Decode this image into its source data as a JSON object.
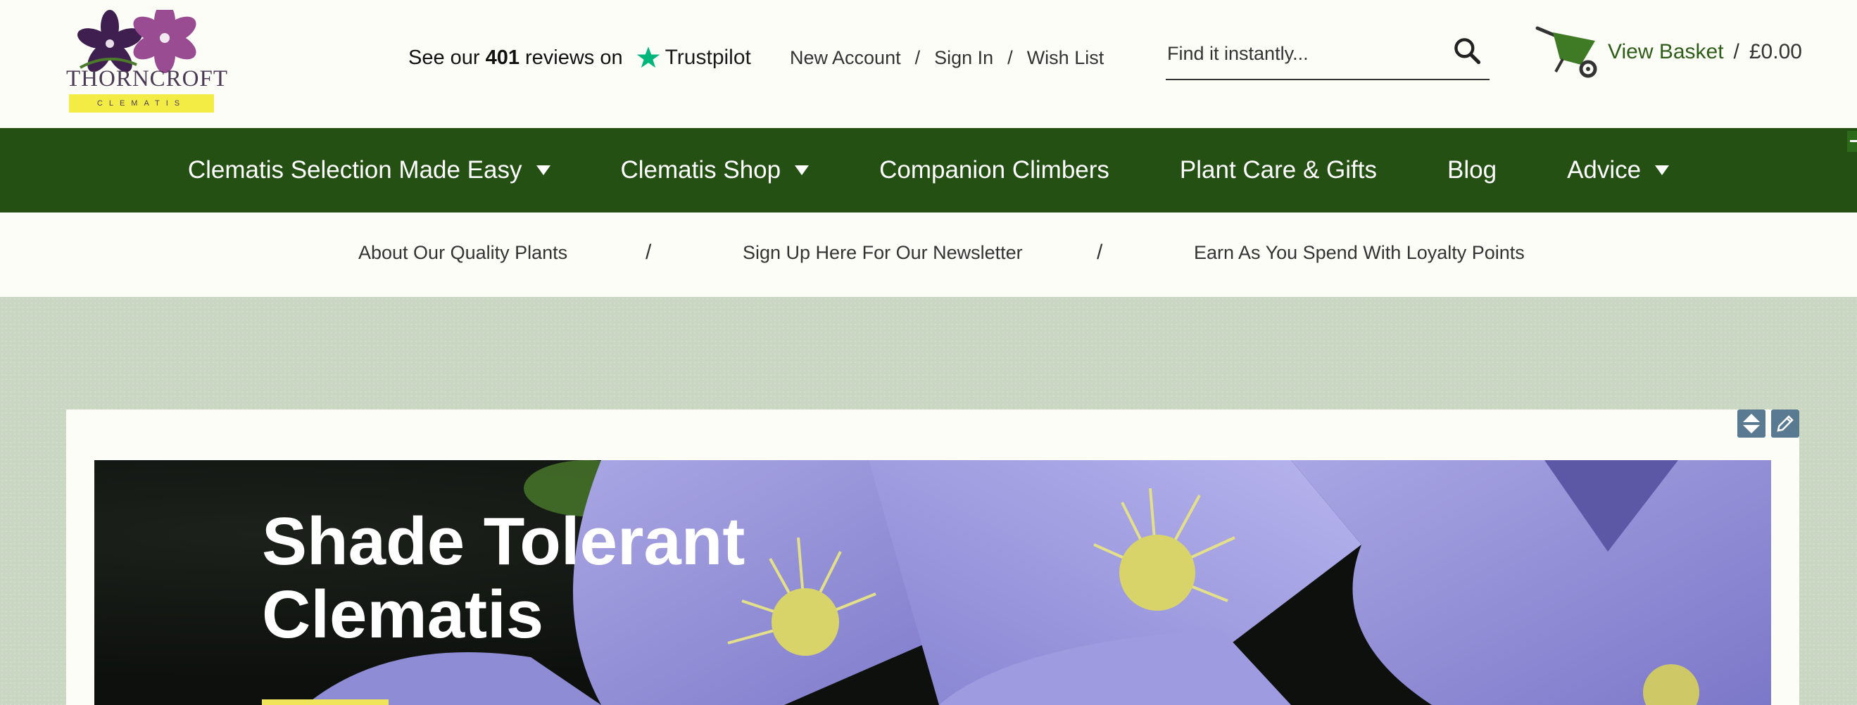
{
  "brand": {
    "name": "THORNCROFT",
    "tagline": "CLEMATIS"
  },
  "trustpilot": {
    "prefix": "See our",
    "count": "401",
    "suffix": "reviews on",
    "name": "Trustpilot",
    "star_color": "#00b67a"
  },
  "account_links": [
    {
      "label": "New Account"
    },
    {
      "label": "Sign In"
    },
    {
      "label": "Wish List"
    }
  ],
  "separators": {
    "slash": "/"
  },
  "search": {
    "placeholder": "Find it instantly...",
    "icon": "magnifier-icon"
  },
  "basket": {
    "icon": "wheelbarrow-icon",
    "label": "View Basket",
    "total": "£0.00"
  },
  "main_nav": [
    {
      "label": "Clematis Selection Made Easy",
      "dropdown": true
    },
    {
      "label": "Clematis Shop",
      "dropdown": true
    },
    {
      "label": "Companion Climbers",
      "dropdown": false
    },
    {
      "label": "Plant Care & Gifts",
      "dropdown": false
    },
    {
      "label": "Blog",
      "dropdown": false
    },
    {
      "label": "Advice",
      "dropdown": true
    }
  ],
  "sub_nav": [
    {
      "label": "About Our Quality Plants"
    },
    {
      "label": "Sign Up Here For Our Newsletter"
    },
    {
      "label": "Earn As You Spend With Loyalty Points"
    }
  ],
  "hero": {
    "title_line1": "Shade Tolerant",
    "title_line2": "Clematis"
  },
  "editor_tools": [
    "reorder-icon",
    "edit-pencil-icon"
  ],
  "colors": {
    "nav_green": "#245013",
    "basket_link": "#2e5d18",
    "page_background": "#cad8c3",
    "hero_button": "#f0e55a",
    "tool_button": "#5a7a92"
  }
}
